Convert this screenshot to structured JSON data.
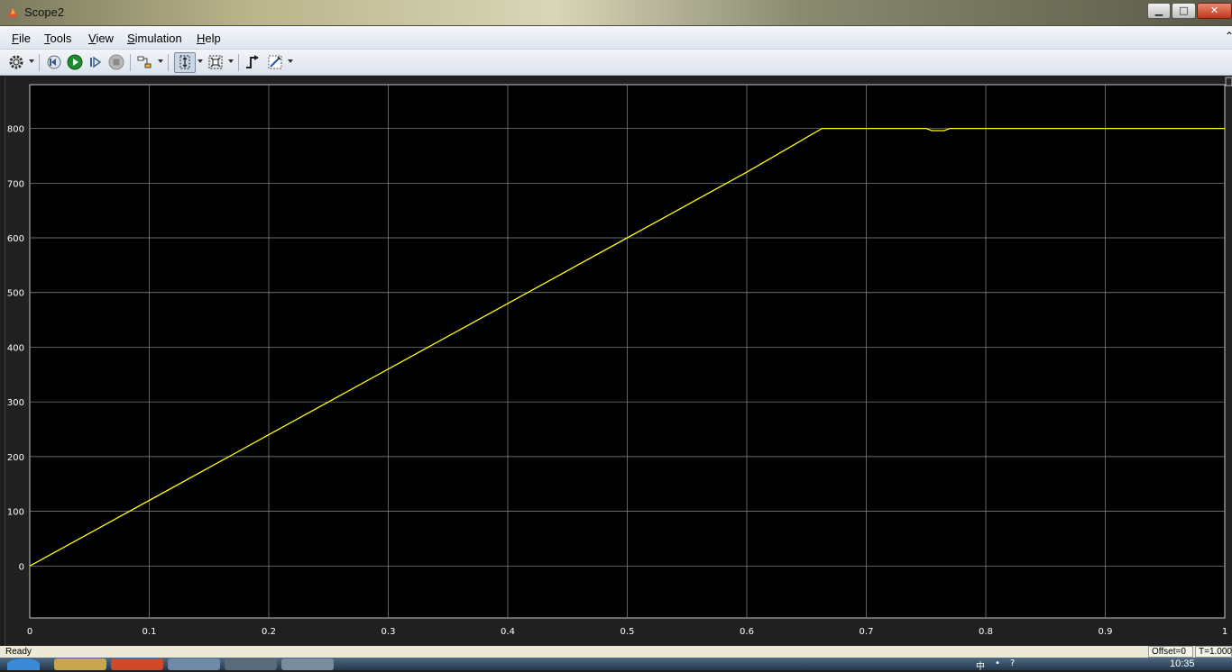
{
  "window": {
    "title": "Scope2",
    "minimize_glyph": "▁",
    "maximize_glyph": "□",
    "close_glyph": "✕"
  },
  "menu": {
    "items": [
      {
        "mnemonic": "F",
        "rest": "ile"
      },
      {
        "mnemonic": "T",
        "rest": "ools"
      },
      {
        "mnemonic": "V",
        "rest": "iew"
      },
      {
        "mnemonic": "S",
        "rest": "imulation"
      },
      {
        "mnemonic": "H",
        "rest": "elp"
      }
    ],
    "overflow_glyph": "⌃"
  },
  "toolbar": {
    "icons": [
      "gear-icon",
      "step-back-icon",
      "run-icon",
      "step-forward-icon",
      "stop-icon",
      "highlight-block-icon",
      "zoom-icon",
      "autoscale-icon",
      "triggers-icon",
      "measurements-icon"
    ]
  },
  "chart_data": {
    "type": "line",
    "title": "",
    "xlabel": "",
    "ylabel": "",
    "xlim": [
      0,
      1
    ],
    "ylim": [
      -95,
      880
    ],
    "x_ticks": [
      "0",
      "0.1",
      "0.2",
      "0.3",
      "0.4",
      "0.5",
      "0.6",
      "0.7",
      "0.8",
      "0.9",
      "1"
    ],
    "y_ticks": [
      "0",
      "100",
      "200",
      "300",
      "400",
      "500",
      "600",
      "700",
      "800"
    ],
    "grid": true,
    "background": "#000000",
    "line_color": "#ffff00",
    "series": [
      {
        "x": [
          0,
          0.1,
          0.2,
          0.3,
          0.4,
          0.5,
          0.6,
          0.663,
          0.67,
          0.75,
          0.755,
          0.765,
          0.77,
          1
        ],
        "y": [
          0,
          120,
          240,
          360,
          480,
          600,
          720,
          800,
          800,
          800,
          796,
          796,
          800,
          800
        ]
      }
    ]
  },
  "status": {
    "ready": "Ready",
    "offset": "Offset=0",
    "time": "T=1.000"
  },
  "taskbar": {
    "clock": "10:35",
    "tray_glyphs": [
      "中",
      "•",
      "?"
    ]
  }
}
